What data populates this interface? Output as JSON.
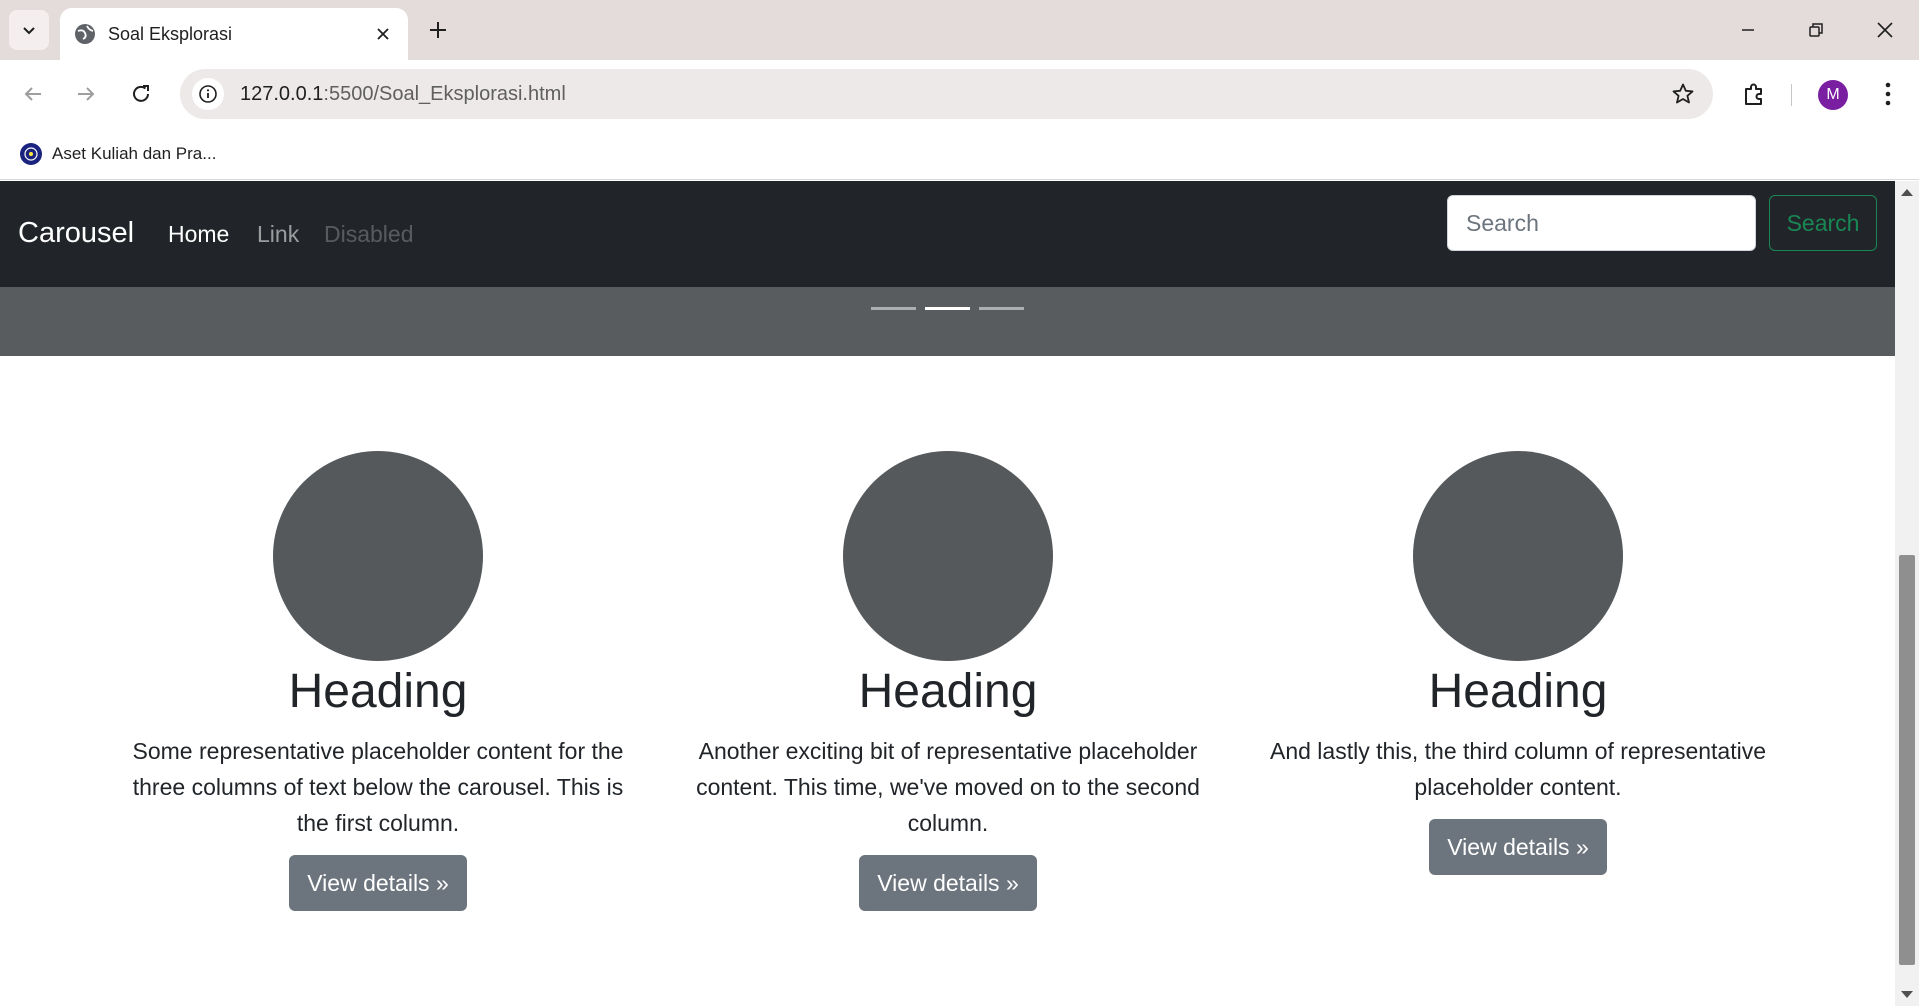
{
  "browser": {
    "tab_title": "Soal Eksplorasi",
    "url_host": "127.0.0.1",
    "url_path": ":5500/Soal_Eksplorasi.html",
    "bookmark_label": "Aset Kuliah dan Pra...",
    "avatar_letter": "M"
  },
  "navbar": {
    "brand": "Carousel",
    "links": [
      "Home",
      "Link",
      "Disabled"
    ],
    "search_placeholder": "Search",
    "search_button": "Search"
  },
  "carousel": {
    "indicators": 3,
    "active_index": 1
  },
  "columns": [
    {
      "heading": "Heading",
      "body": "Some representative placeholder content for the three columns of text below the carousel. This is the first column.",
      "button": "View details »"
    },
    {
      "heading": "Heading",
      "body": "Another exciting bit of representative placeholder content. This time, we've moved on to the second column.",
      "button": "View details »"
    },
    {
      "heading": "Heading",
      "body": "And lastly this, the third column of representative placeholder content.",
      "button": "View details »"
    }
  ],
  "colors": {
    "navbar_bg": "#212529",
    "carousel_bg": "#595c5f",
    "placeholder_circle": "#55595c",
    "button_secondary": "#6c757d",
    "search_outline": "#198754"
  }
}
